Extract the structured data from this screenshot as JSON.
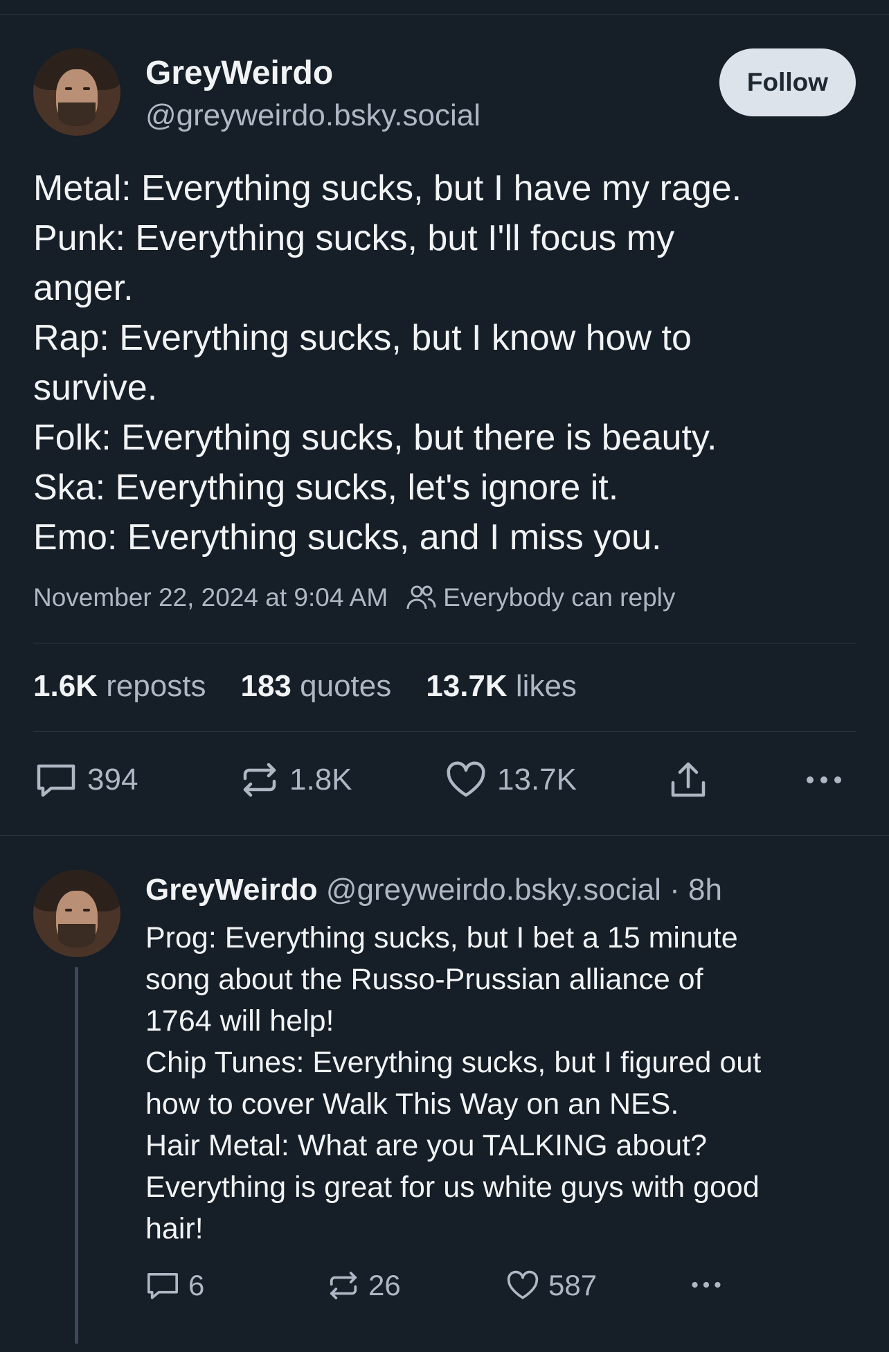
{
  "post": {
    "author_name": "GreyWeirdo",
    "author_handle": "@greyweirdo.bsky.social",
    "follow_label": "Follow",
    "text_lines": [
      "Metal: Everything sucks, but I have my rage.",
      "Punk: Everything sucks, but I'll focus my",
      "anger.",
      "Rap: Everything sucks, but I know how to",
      "survive.",
      "Folk: Everything sucks, but there is beauty.",
      "Ska: Everything sucks, let's ignore it.",
      "Emo: Everything sucks, and I miss you."
    ],
    "timestamp": "November 22, 2024 at 9:04 AM",
    "reply_setting": "Everybody can reply",
    "stats": {
      "reposts_count": "1.6K",
      "reposts_label": "reposts",
      "quotes_count": "183",
      "quotes_label": "quotes",
      "likes_count": "13.7K",
      "likes_label": "likes"
    },
    "actions": {
      "replies": "394",
      "reposts": "1.8K",
      "likes": "13.7K"
    }
  },
  "reply": {
    "author_name": "GreyWeirdo",
    "author_handle": "@greyweirdo.bsky.social",
    "time": "· 8h",
    "text_lines": [
      "Prog: Everything sucks, but I bet a 15 minute",
      "song about the Russo-Prussian alliance of",
      "1764 will help!",
      "Chip Tunes: Everything sucks, but I figured out",
      "how to cover Walk This Way on an NES.",
      "Hair Metal: What are you TALKING about?",
      "Everything is great for us white guys with good",
      "hair!"
    ],
    "actions": {
      "replies": "6",
      "reposts": "26",
      "likes": "587"
    }
  },
  "icons": {
    "reply": "comment-icon",
    "repost": "repost-icon",
    "like": "heart-icon",
    "share": "share-icon",
    "more": "more-icon",
    "people": "people-icon"
  },
  "colors": {
    "background": "#161e27",
    "text": "#f1f3f5",
    "muted": "#aeb8c4",
    "follow_button": "#dde3ea"
  }
}
